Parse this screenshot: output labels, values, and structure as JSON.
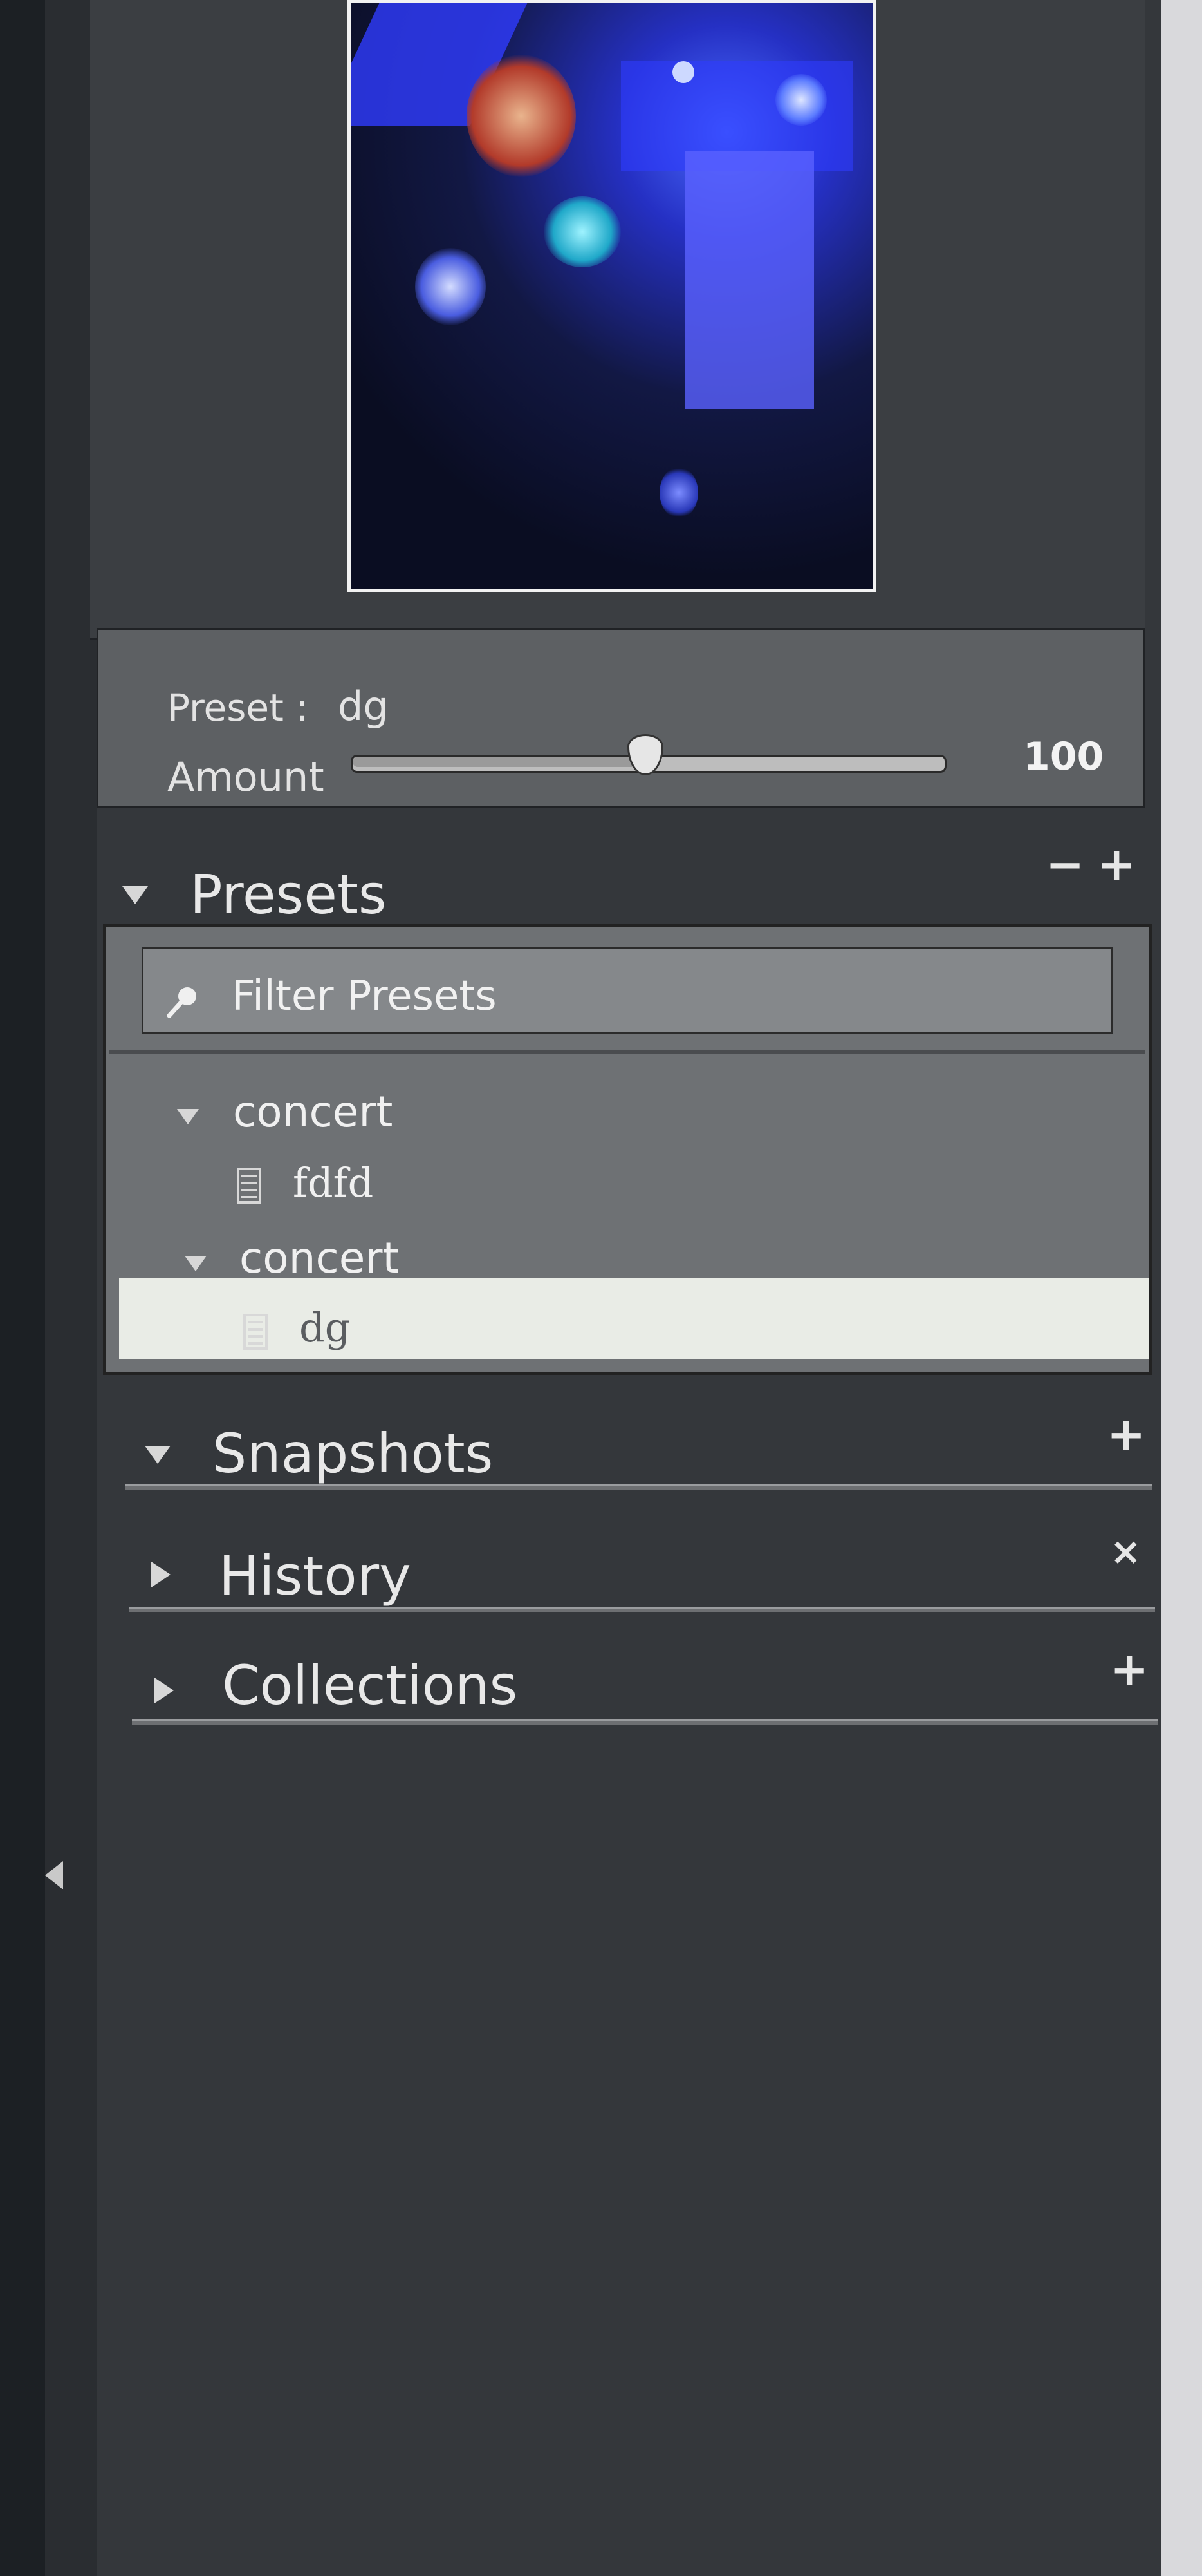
{
  "navigator": {
    "image_alt": ""
  },
  "preset_panel": {
    "preset_label": "Preset :",
    "preset_value": "dg",
    "amount_label": "Amount",
    "amount_value": "100",
    "amount_fraction": 0.5
  },
  "presets": {
    "title": "Presets",
    "remove_icon": "−",
    "add_icon": "+",
    "filter_placeholder": "Filter Presets",
    "groups": [
      {
        "label": "concert",
        "items": [
          "fdfd"
        ]
      },
      {
        "label": "concert",
        "items": [
          "dg"
        ]
      }
    ],
    "selected_item": "dg"
  },
  "sections": {
    "snapshots": {
      "title": "Snapshots",
      "icon": "+"
    },
    "history": {
      "title": "History",
      "icon": "×"
    },
    "collections": {
      "title": "Collections",
      "icon": "+"
    }
  },
  "colors": {
    "panel": "#34373b",
    "selected_row": "#e9ece6",
    "accent_photo": "#2f3cff"
  },
  "icons": [
    "search-icon",
    "document-icon",
    "triangle-down-icon",
    "triangle-right-icon",
    "collapse-left-icon"
  ]
}
